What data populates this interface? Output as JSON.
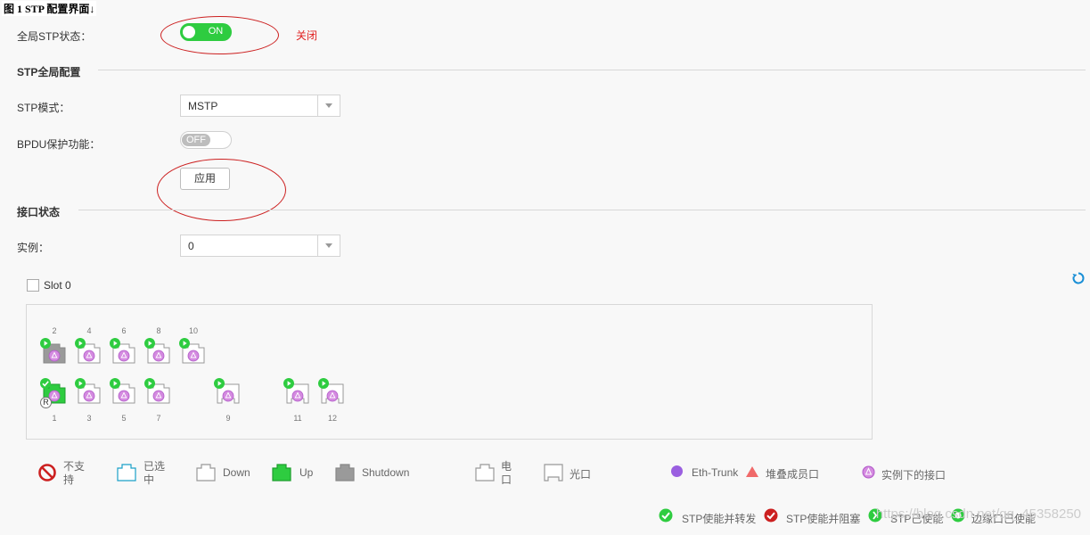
{
  "caption": "图 1 STP 配置界面↓",
  "global_stp": {
    "label": "全局STP状态：",
    "toggle_text": "ON",
    "close_link": "关闭"
  },
  "section_global": {
    "title": "STP全局配置",
    "mode_label": "STP模式：",
    "mode_value": "MSTP",
    "bpdu_label": "BPDU保护功能：",
    "bpdu_toggle_text": "OFF",
    "apply_label": "应用"
  },
  "section_ports": {
    "title": "接口状态",
    "instance_label": "实例：",
    "instance_value": "0",
    "slot_label": "Slot 0"
  },
  "ports_top": [
    {
      "num": "2",
      "state": "shutdown"
    },
    {
      "num": "4",
      "state": "down"
    },
    {
      "num": "6",
      "state": "down"
    },
    {
      "num": "8",
      "state": "down"
    },
    {
      "num": "10",
      "state": "down"
    }
  ],
  "ports_bottom": [
    {
      "num": "1",
      "state": "up",
      "badge": "R"
    },
    {
      "num": "3",
      "state": "down"
    },
    {
      "num": "5",
      "state": "down"
    },
    {
      "num": "7",
      "state": "down"
    },
    {
      "num": "9",
      "state": "down-fiber"
    },
    {
      "num": "11",
      "state": "down-fiber"
    },
    {
      "num": "12",
      "state": "down-fiber"
    }
  ],
  "legend_row1": {
    "unsupported": "不支持",
    "selected": "已选中",
    "down": "Down",
    "up": "Up",
    "shutdown": "Shutdown",
    "electrical": "电口",
    "optical": "光口",
    "eth_trunk": "Eth-Trunk",
    "stack_member": "堆叠成员口",
    "instance_port": "实例下的接口"
  },
  "legend_row2": {
    "forwarding": "STP使能并转发",
    "blocking": "STP使能并阻塞",
    "enabled": "STP已使能",
    "edge_enabled": "边缘口已使能"
  },
  "watermark": "https://blog.csdn.net/qq_45358250",
  "colors": {
    "green": "#2ecc40",
    "red": "#cc2020",
    "purple": "#c86ad4",
    "blue": "#1a8fd6"
  }
}
